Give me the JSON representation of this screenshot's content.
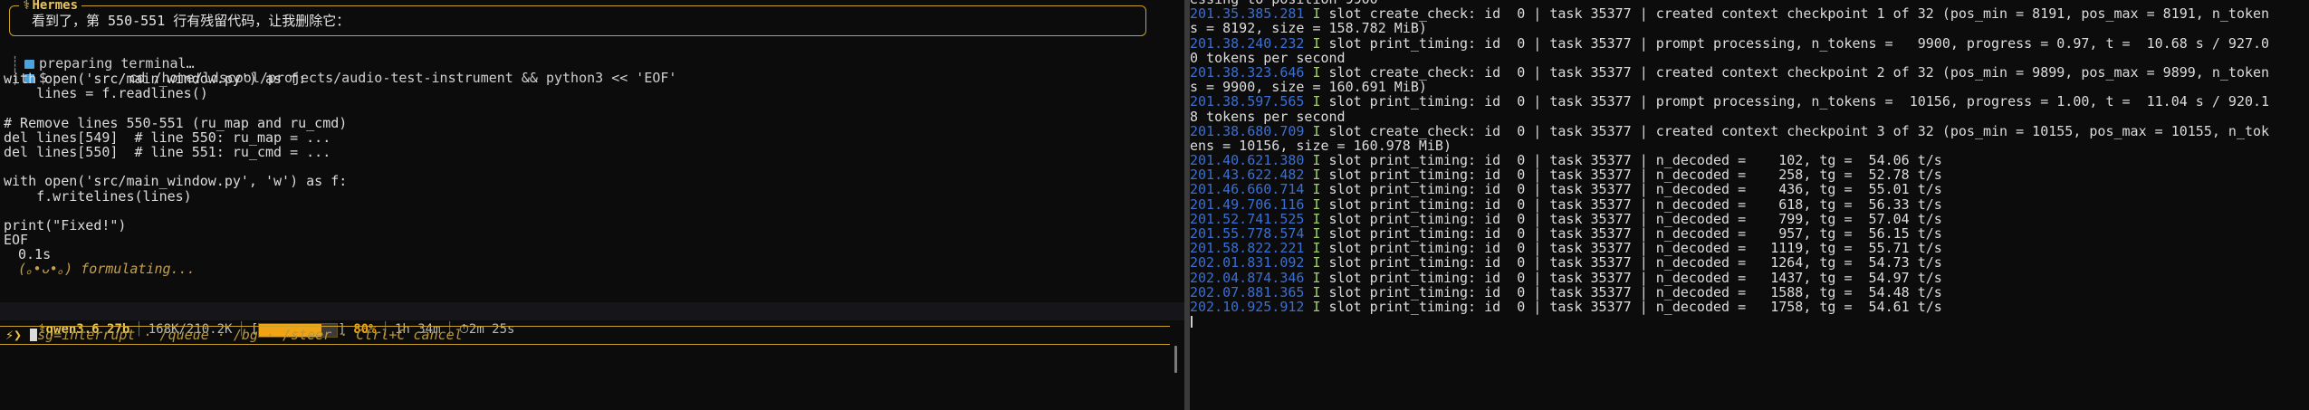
{
  "left_pane": {
    "agent_name": "Hermes",
    "message": "看到了，第 550-551 行有残留代码，让我删除它：",
    "tool_status": "preparing terminal…",
    "command_symbol": "$",
    "command": "cd /home/ldscool/projects/audio-test-instrument && python3 << 'EOF'",
    "code_lines": [
      "with open('src/main_window.py') as f:",
      "    lines = f.readlines()",
      "",
      "# Remove lines 550-551 (ru_map and ru_cmd)",
      "del lines[549]  # line 550: ru_map = ...",
      "del lines[550]  # line 551: ru_cmd = ...",
      "",
      "with open('src/main_window.py', 'w') as f:",
      "    f.writelines(lines)",
      "",
      "print(\"Fixed!\")",
      "EOF"
    ],
    "elapsed": "0.1s",
    "formulating": "(｡•ᴗ•｡) formulating..."
  },
  "status_bar": {
    "model": "qwen3.6 27b",
    "tokens": "168K/210.2K",
    "progress_value": 0.8,
    "progress_pct": "80%",
    "uptime": "1h 34m",
    "timer": "2m 25s"
  },
  "prompt": {
    "glyph": "⚡❯",
    "hint": "sg=interrupt · /queue · /bg · /steer · Ctrl+C cancel"
  },
  "right_pane": {
    "log_lines": [
      {
        "ts": "",
        "lvl": "",
        "text": "essing to position 9900"
      },
      {
        "ts": "201.35.385.281",
        "lvl": "I",
        "text": "slot create_check: id  0 | task 35377 | created context checkpoint 1 of 32 (pos_min = 8191, pos_max = 8191, n_token"
      },
      {
        "ts": "",
        "lvl": "",
        "text": "s = 8192, size = 158.782 MiB)"
      },
      {
        "ts": "201.38.240.232",
        "lvl": "I",
        "text": "slot print_timing: id  0 | task 35377 | prompt processing, n_tokens =   9900, progress = 0.97, t =  10.68 s / 927.0"
      },
      {
        "ts": "",
        "lvl": "",
        "text": "0 tokens per second"
      },
      {
        "ts": "201.38.323.646",
        "lvl": "I",
        "text": "slot create_check: id  0 | task 35377 | created context checkpoint 2 of 32 (pos_min = 9899, pos_max = 9899, n_token"
      },
      {
        "ts": "",
        "lvl": "",
        "text": "s = 9900, size = 160.691 MiB)"
      },
      {
        "ts": "201.38.597.565",
        "lvl": "I",
        "text": "slot print_timing: id  0 | task 35377 | prompt processing, n_tokens =  10156, progress = 1.00, t =  11.04 s / 920.1"
      },
      {
        "ts": "",
        "lvl": "",
        "text": "8 tokens per second"
      },
      {
        "ts": "201.38.680.709",
        "lvl": "I",
        "text": "slot create_check: id  0 | task 35377 | created context checkpoint 3 of 32 (pos_min = 10155, pos_max = 10155, n_tok"
      },
      {
        "ts": "",
        "lvl": "",
        "text": "ens = 10156, size = 160.978 MiB)"
      },
      {
        "ts": "201.40.621.380",
        "lvl": "I",
        "text": "slot print_timing: id  0 | task 35377 | n_decoded =    102, tg =  54.06 t/s"
      },
      {
        "ts": "201.43.622.482",
        "lvl": "I",
        "text": "slot print_timing: id  0 | task 35377 | n_decoded =    258, tg =  52.78 t/s"
      },
      {
        "ts": "201.46.660.714",
        "lvl": "I",
        "text": "slot print_timing: id  0 | task 35377 | n_decoded =    436, tg =  55.01 t/s"
      },
      {
        "ts": "201.49.706.116",
        "lvl": "I",
        "text": "slot print_timing: id  0 | task 35377 | n_decoded =    618, tg =  56.33 t/s"
      },
      {
        "ts": "201.52.741.525",
        "lvl": "I",
        "text": "slot print_timing: id  0 | task 35377 | n_decoded =    799, tg =  57.04 t/s"
      },
      {
        "ts": "201.55.778.574",
        "lvl": "I",
        "text": "slot print_timing: id  0 | task 35377 | n_decoded =    957, tg =  56.15 t/s"
      },
      {
        "ts": "201.58.822.221",
        "lvl": "I",
        "text": "slot print_timing: id  0 | task 35377 | n_decoded =   1119, tg =  55.71 t/s"
      },
      {
        "ts": "202.01.831.092",
        "lvl": "I",
        "text": "slot print_timing: id  0 | task 35377 | n_decoded =   1264, tg =  54.73 t/s"
      },
      {
        "ts": "202.04.874.346",
        "lvl": "I",
        "text": "slot print_timing: id  0 | task 35377 | n_decoded =   1437, tg =  54.97 t/s"
      },
      {
        "ts": "202.07.881.365",
        "lvl": "I",
        "text": "slot print_timing: id  0 | task 35377 | n_decoded =   1588, tg =  54.48 t/s"
      },
      {
        "ts": "202.10.925.912",
        "lvl": "I",
        "text": "slot print_timing: id  0 | task 35377 | n_decoded =   1758, tg =  54.61 t/s"
      }
    ]
  },
  "colors": {
    "accent": "#c9a227",
    "timestamp": "#3a6fd4",
    "level": "#9ecf6a",
    "progress": "#f0a414"
  }
}
